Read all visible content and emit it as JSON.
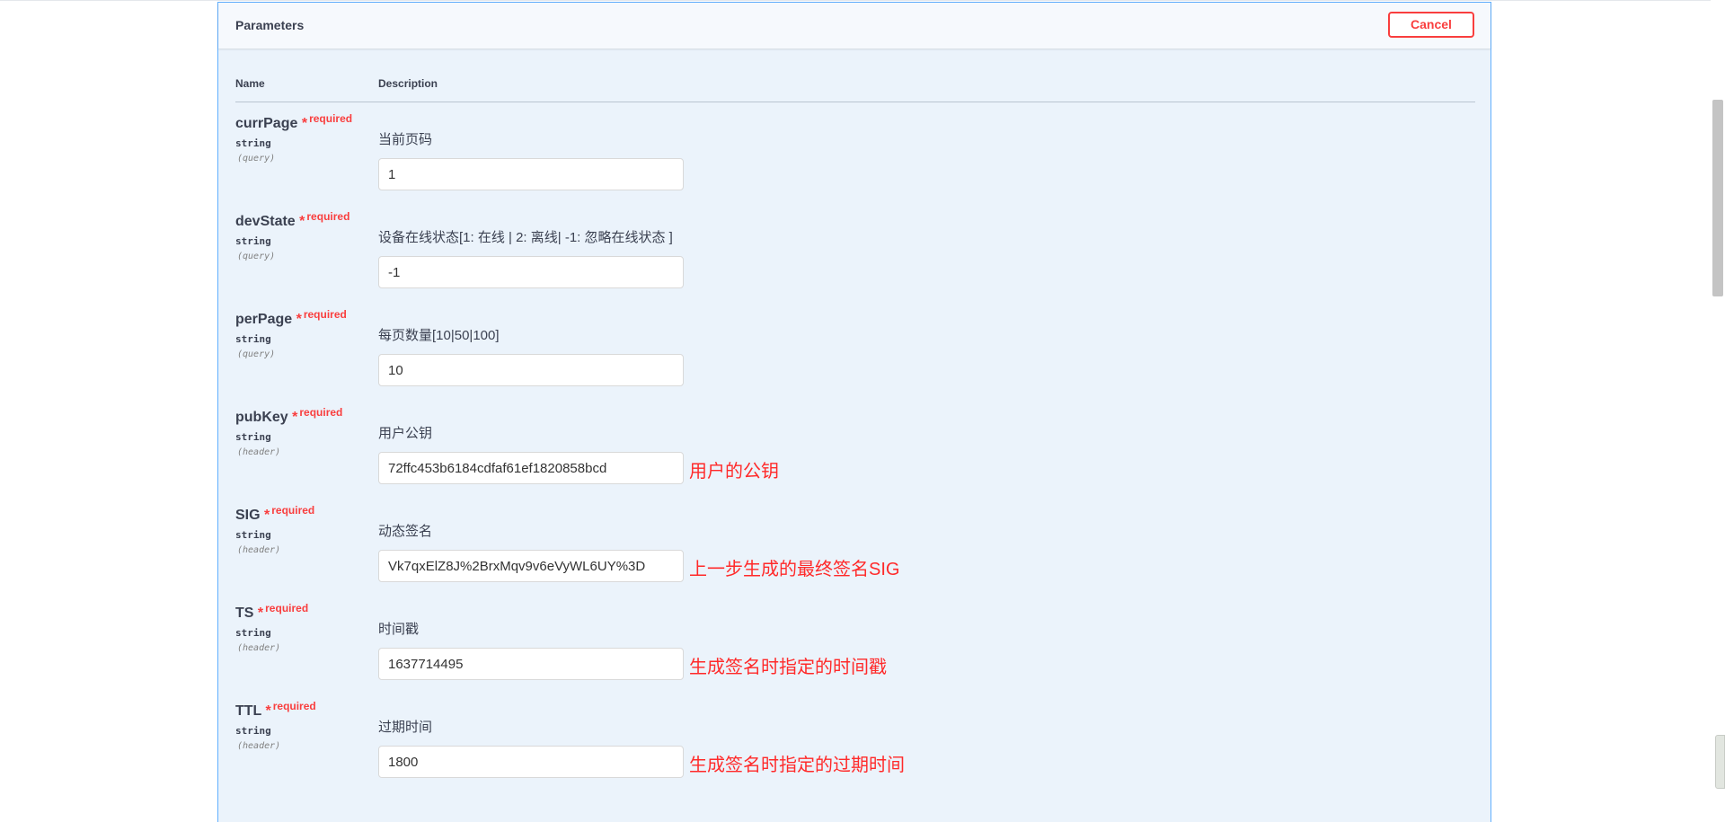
{
  "header": {
    "title": "Parameters",
    "cancel_label": "Cancel"
  },
  "columns": {
    "name": "Name",
    "description": "Description"
  },
  "params": [
    {
      "name": "currPage",
      "required_star": "*",
      "required_label": "required",
      "type": "string",
      "in": "(query)",
      "description": "当前页码",
      "value": "1",
      "note": ""
    },
    {
      "name": "devState",
      "required_star": "*",
      "required_label": "required",
      "type": "string",
      "in": "(query)",
      "description": "设备在线状态[1: 在线 | 2: 离线| -1: 忽略在线状态 ]",
      "value": "-1",
      "note": ""
    },
    {
      "name": "perPage",
      "required_star": "*",
      "required_label": "required",
      "type": "string",
      "in": "(query)",
      "description": "每页数量[10|50|100]",
      "value": "10",
      "note": ""
    },
    {
      "name": "pubKey",
      "required_star": "*",
      "required_label": "required",
      "type": "string",
      "in": "(header)",
      "description": "用户公钥",
      "value": "72ffc453b6184cdfaf61ef1820858bcd",
      "note": "用户的公钥"
    },
    {
      "name": "SIG",
      "required_star": "*",
      "required_label": "required",
      "type": "string",
      "in": "(header)",
      "description": "动态签名",
      "value": "Vk7qxElZ8J%2BrxMqv9v6eVyWL6UY%3D",
      "note": "上一步生成的最终签名SIG"
    },
    {
      "name": "TS",
      "required_star": "*",
      "required_label": "required",
      "type": "string",
      "in": "(header)",
      "description": "时间戳",
      "value": "1637714495",
      "note": "生成签名时指定的时间戳"
    },
    {
      "name": "TTL",
      "required_star": "*",
      "required_label": "required",
      "type": "string",
      "in": "(header)",
      "description": "过期时间",
      "value": "1800",
      "note": "生成签名时指定的过期时间"
    }
  ],
  "colors": {
    "accent_border": "#61affe",
    "panel_background": "#ebf3fb",
    "required": "#f93e3e",
    "annotation": "#ff2a2a"
  }
}
